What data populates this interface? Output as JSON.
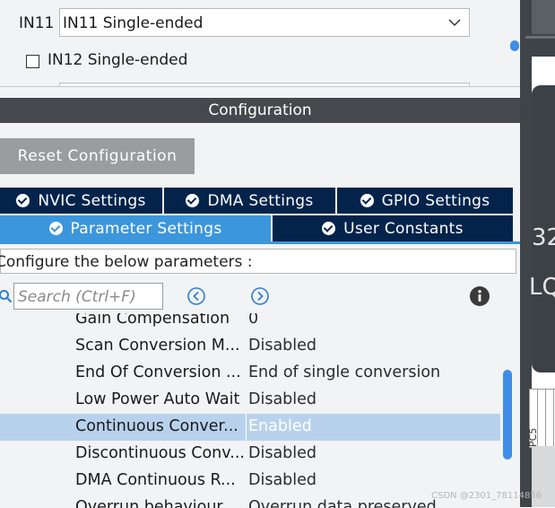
{
  "top": {
    "in11_label": "IN11",
    "in11_value": "IN11 Single-ended",
    "in12_label": "IN12 Single-ended",
    "in12_checked": false
  },
  "config": {
    "title": "Configuration",
    "reset_label": "Reset Configuration",
    "tabs": [
      {
        "label": "NVIC Settings",
        "active": false
      },
      {
        "label": "DMA Settings",
        "active": false
      },
      {
        "label": "GPIO Settings",
        "active": false
      },
      {
        "label": "Parameter Settings",
        "active": true
      },
      {
        "label": "User Constants",
        "active": false
      }
    ],
    "configure_text": "Configure the below parameters :",
    "search_placeholder": "Search (Ctrl+F)",
    "rows": [
      {
        "name": "Gain Compensation",
        "value": "0"
      },
      {
        "name": "Scan Conversion M...",
        "value": "Disabled"
      },
      {
        "name": "End Of Conversion ...",
        "value": "End of single conversion"
      },
      {
        "name": "Low Power Auto Wait",
        "value": "Disabled"
      },
      {
        "name": "Continuous Conver...",
        "value": "Enabled",
        "selected": true
      },
      {
        "name": "Discontinuous Conv...",
        "value": "Disabled"
      },
      {
        "name": "DMA Continuous R...",
        "value": "Disabled"
      },
      {
        "name": "Overrun behaviour",
        "value": "Overrun data preserved"
      }
    ]
  },
  "chip": {
    "text_1": "32",
    "text_2": "LQ",
    "pin_label": "PC5"
  },
  "watermark": "CSDN @2301_78114856",
  "colors": {
    "tab_bg": "#03234b",
    "tab_active": "#3c96dc",
    "titlebar": "#45494d",
    "selected_row": "#b8d2ed",
    "scrollbar": "#3e8de6"
  },
  "icons": {
    "search": "search-icon",
    "collapse": "collapse-all-icon",
    "expand": "expand-all-icon",
    "info": "info-icon",
    "dropdown": "chevron-down-icon"
  }
}
